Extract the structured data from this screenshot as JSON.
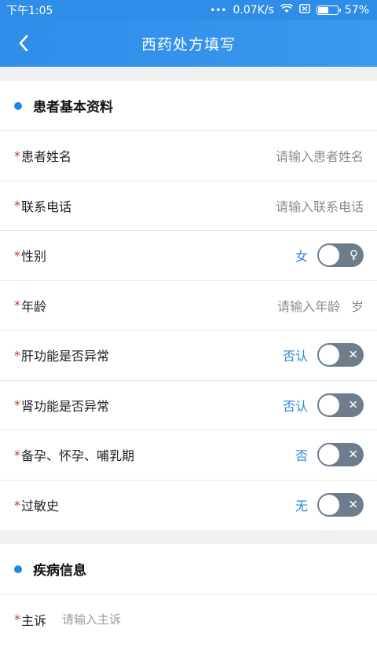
{
  "status_bar": {
    "time": "下午1:05",
    "dots": "•••",
    "network_speed": "0.07K/s",
    "battery_percent": "57%",
    "battery_level": 0.57
  },
  "nav": {
    "title": "西药处方填写"
  },
  "patient_section": {
    "title": "患者基本资料",
    "required_mark": "*",
    "fields": {
      "name": {
        "label": "患者姓名",
        "placeholder": "请输入患者姓名"
      },
      "phone": {
        "label": "联系电话",
        "placeholder": "请输入联系电话"
      },
      "gender": {
        "label": "性别",
        "value": "女",
        "icon": "♀"
      },
      "age": {
        "label": "年龄",
        "placeholder": "请输入年龄",
        "unit": "岁"
      },
      "liver": {
        "label": "肝功能是否异常",
        "value": "否认",
        "icon": "✕"
      },
      "kidney": {
        "label": "肾功能是否异常",
        "value": "否认",
        "icon": "✕"
      },
      "pregnancy": {
        "label": "备孕、怀孕、哺乳期",
        "value": "否",
        "icon": "✕"
      },
      "allergy": {
        "label": "过敏史",
        "value": "无",
        "icon": "✕"
      }
    }
  },
  "disease_section": {
    "title": "疾病信息",
    "complaint": {
      "label": "主诉",
      "placeholder": "请输入主诉"
    }
  },
  "colors": {
    "primary": "#2f8de8",
    "accent_text": "#2b86df",
    "required": "#d9302c",
    "toggle_off": "#6e7d8c"
  }
}
